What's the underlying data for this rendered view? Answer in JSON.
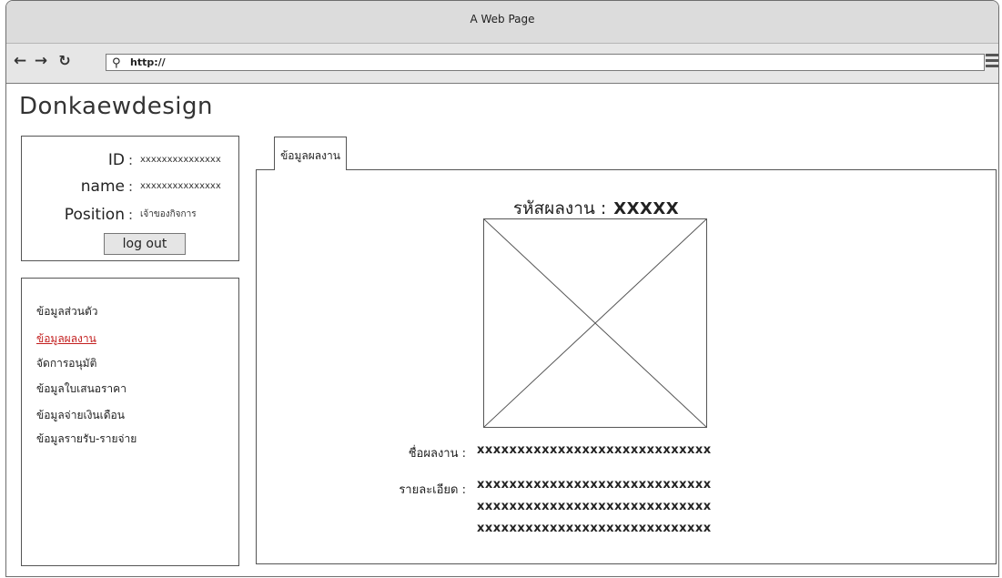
{
  "window": {
    "title": "A Web Page"
  },
  "browser": {
    "url": "http://"
  },
  "brand": "Donkaewdesign",
  "user": {
    "id_label": "ID",
    "id_value": "xxxxxxxxxxxxxxx",
    "name_label": "name",
    "name_value": "xxxxxxxxxxxxxxx",
    "position_label": "Position",
    "position_value": "เจ้าของกิจการ",
    "colon": ":",
    "logout_label": "log out"
  },
  "sidebar": {
    "items": [
      {
        "label": "ข้อมูลส่วนตัว"
      },
      {
        "label": "ข้อมูลผลงาน"
      },
      {
        "label": "จัดการอนุมัติ"
      },
      {
        "label": "ข้อมูลใบเสนอราคา"
      },
      {
        "label": "ข้อมูลจ่ายเงินเดือน"
      },
      {
        "label": "ข้อมูลรายรับ-รายจ่าย"
      }
    ],
    "active_index": 1
  },
  "tab": {
    "label": "ข้อมูลผลงาน"
  },
  "work": {
    "code_label": "รหัสผลงาน",
    "colon": ":",
    "code_value": "XXXXX",
    "name_label": "ชื่อผลงาน :",
    "name_value": "xxxxxxxxxxxxxxxxxxxxxxxxxxxxx",
    "detail_label": "รายละเอียด :",
    "detail_lines": [
      "xxxxxxxxxxxxxxxxxxxxxxxxxxxxx",
      "xxxxxxxxxxxxxxxxxxxxxxxxxxxxx",
      "xxxxxxxxxxxxxxxxxxxxxxxxxxxxx"
    ]
  },
  "colors": {
    "active_link": "#c31f1f",
    "chrome": "#dcdcdc"
  }
}
